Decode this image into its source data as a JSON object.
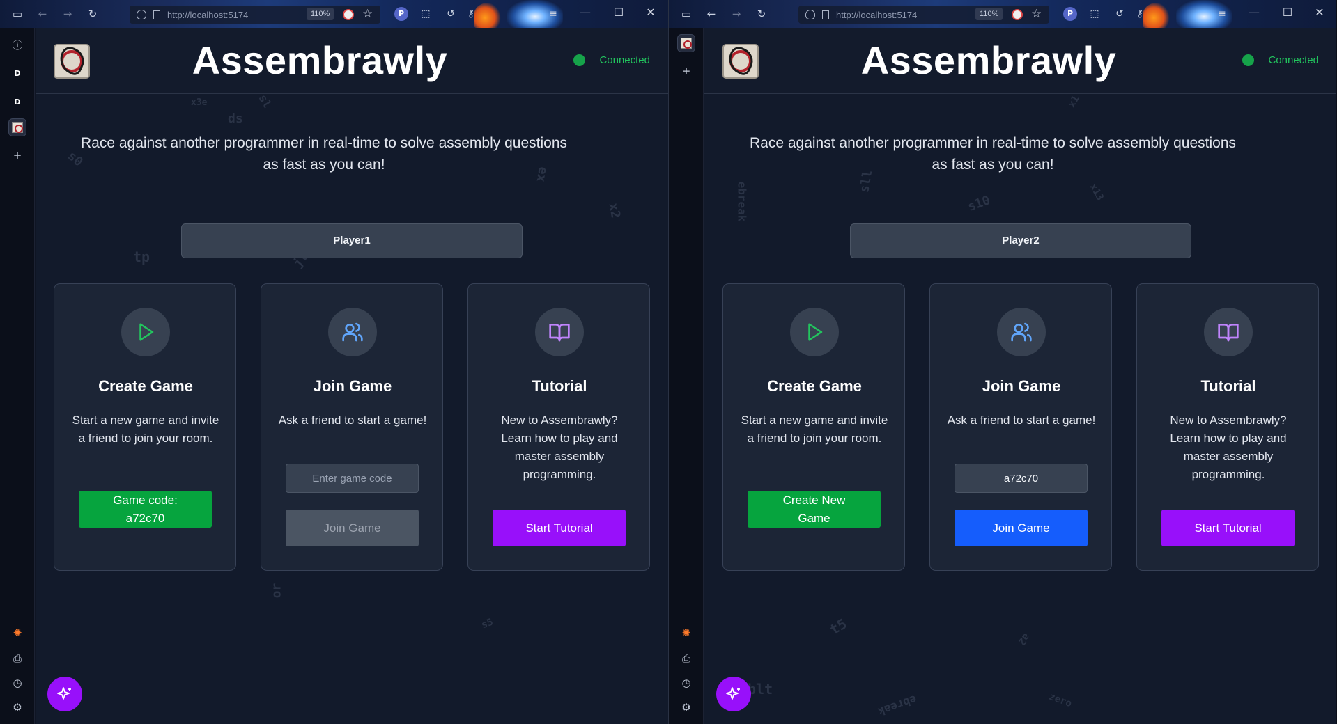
{
  "windows": [
    {
      "browser": {
        "url": "http://localhost:5174",
        "zoom": "110%"
      },
      "sidebar": {
        "items": [
          "info-icon",
          "D",
          "D",
          "app-tab",
          "plus-icon"
        ],
        "bottom": [
          "sparkle-icon",
          "save-icon",
          "clock-icon",
          "gear-icon"
        ]
      },
      "app": {
        "title": "Assembrawly",
        "status": "Connected",
        "tagline_line1": "Race against another programmer in real-time to solve assembly questions",
        "tagline_line2": "as fast as you can!",
        "player_name": "Player1",
        "cards": {
          "create": {
            "title": "Create Game",
            "desc": "Start a new game and invite a friend to join your room.",
            "button_line1": "Game code:",
            "button_line2": "a72c70"
          },
          "join": {
            "title": "Join Game",
            "desc": "Ask a friend to start a game!",
            "input_value": "",
            "input_placeholder": "Enter game code",
            "button": "Join Game",
            "button_state": "disabled"
          },
          "tutorial": {
            "title": "Tutorial",
            "desc": "New to Assembrawly? Learn how to play and master assembly programming.",
            "button": "Start Tutorial"
          }
        }
      },
      "bg_words": [
        "x3e",
        "ds",
        "sl",
        "s0",
        "ex",
        "tp",
        "jl",
        "or",
        "s5",
        "x2"
      ]
    },
    {
      "browser": {
        "url": "http://localhost:5174",
        "zoom": "110%"
      },
      "sidebar": {
        "items": [
          "app-tab",
          "plus-icon"
        ],
        "bottom": [
          "sparkle-icon",
          "save-icon",
          "clock-icon",
          "gear-icon"
        ]
      },
      "app": {
        "title": "Assembrawly",
        "status": "Connected",
        "tagline_line1": "Race against another programmer in real-time to solve assembly questions",
        "tagline_line2": "as fast as you can!",
        "player_name": "Player2",
        "cards": {
          "create": {
            "title": "Create Game",
            "desc": "Start a new game and invite a friend to join your room.",
            "button_line1": "Create New",
            "button_line2": "Game"
          },
          "join": {
            "title": "Join Game",
            "desc": "Ask a friend to start a game!",
            "input_value": "a72c70",
            "input_placeholder": "Enter game code",
            "button": "Join Game",
            "button_state": "enabled"
          },
          "tutorial": {
            "title": "Tutorial",
            "desc": "New to Assembrawly? Learn how to play and master assembly programming.",
            "button": "Start Tutorial"
          }
        }
      },
      "bg_words": [
        "ebreak",
        "sll",
        "s10",
        "x13",
        "x1",
        "t5",
        "blt",
        "ebreak",
        "a2",
        "zero"
      ]
    }
  ],
  "colors": {
    "accent_green": "#06a43e",
    "accent_purple": "#9810fa",
    "accent_blue": "#155dfc",
    "status_green": "#22c55e"
  }
}
